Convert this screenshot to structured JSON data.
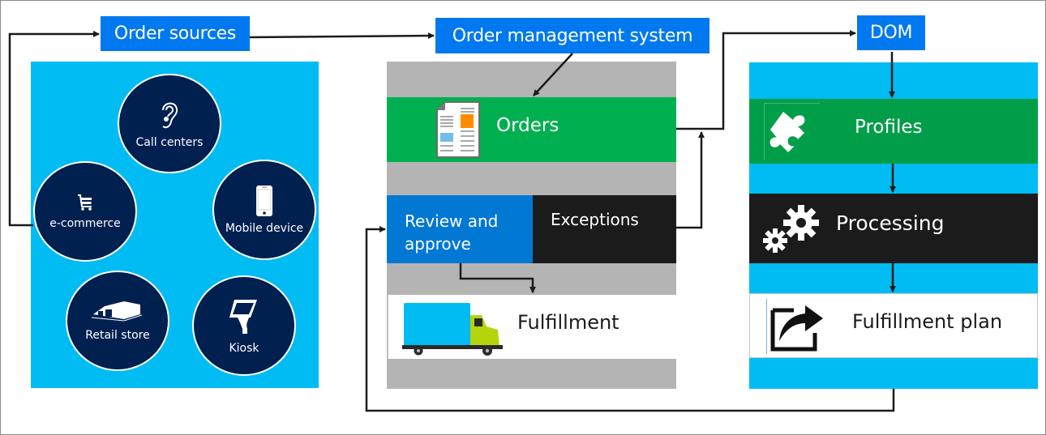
{
  "diagram": {
    "headers": {
      "order_sources": "Order sources",
      "oms": "Order management system",
      "dom": "DOM"
    },
    "order_sources": [
      {
        "label": "Call centers",
        "icon": "ear-icon"
      },
      {
        "label": "e-commerce",
        "icon": "shopping-cart-icon"
      },
      {
        "label": "Mobile device",
        "icon": "mobile-phone-icon"
      },
      {
        "label": "Retail store",
        "icon": "store-building-icon"
      },
      {
        "label": "Kiosk",
        "icon": "kiosk-icon"
      }
    ],
    "oms_steps": {
      "orders": "Orders",
      "review": "Review and approve",
      "exceptions": "Exceptions",
      "fulfillment": "Fulfillment"
    },
    "dom_steps": {
      "profiles": "Profiles",
      "processing": "Processing",
      "fulfillment_plan": "Fulfillment plan"
    },
    "colors": {
      "header_blue": "#0078f0",
      "cyan_panel": "#00bcf2",
      "navy_circle": "#002050",
      "gray_panel": "#b4b4b4",
      "orders_green": "#00b050",
      "profiles_green": "#009e49",
      "review_blue": "#0078d4",
      "dark_band": "#1b1b1b"
    }
  }
}
